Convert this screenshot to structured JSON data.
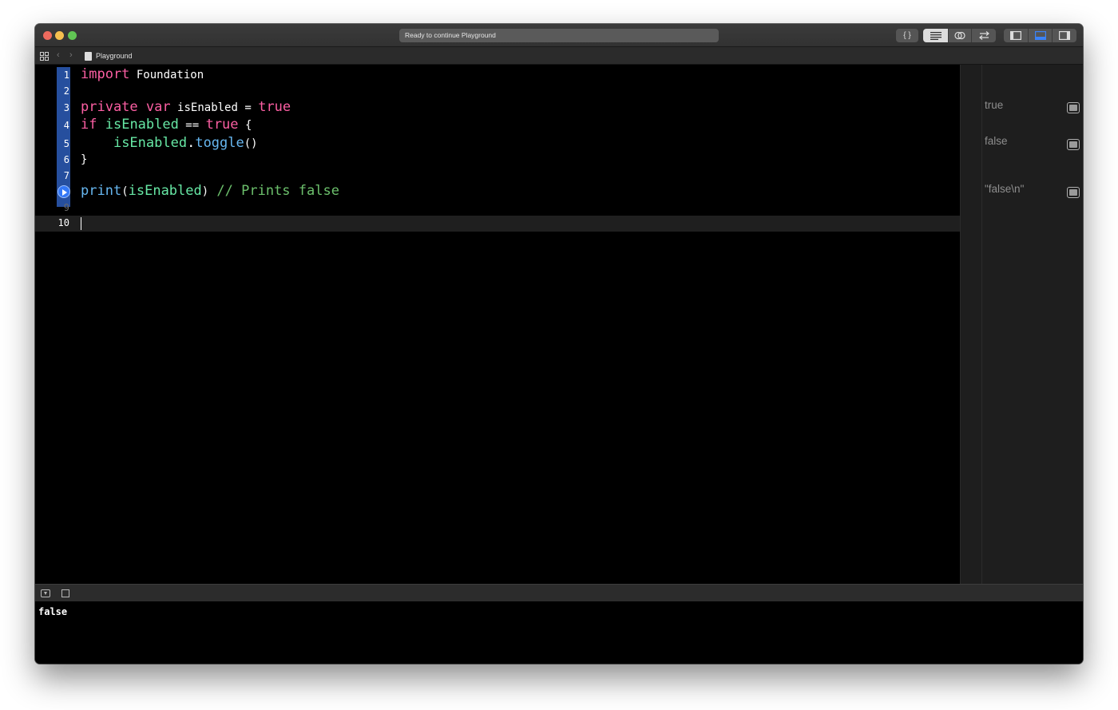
{
  "window": {
    "status": "Ready to continue Playground"
  },
  "toolbar": {
    "code_review_label": "{ }",
    "standard_editor_icon": "lines-icon",
    "assistant_editor_icon": "overlap-circles-icon",
    "version_editor_icon": "swap-arrows-icon",
    "navigator_icon": "left-panel-icon",
    "debug_area_icon": "bottom-panel-icon",
    "inspector_icon": "right-panel-icon"
  },
  "jumpbar": {
    "back": "‹",
    "forward": "›",
    "file_name": "Playground"
  },
  "editor": {
    "line_numbers": [
      "1",
      "2",
      "3",
      "4",
      "5",
      "6",
      "7",
      "",
      "9",
      "10"
    ],
    "lines": [
      {
        "t1": "import",
        "t2": " Foundation"
      },
      {
        "t1": "private",
        "t2": " ",
        "t3": "var",
        "t4": " isEnabled = ",
        "t5": "true"
      },
      {
        "t1": "if",
        "t2": " ",
        "t3": "isEnabled",
        "t4": " == ",
        "t5": "true",
        "t6": " {"
      },
      {
        "t1": "    ",
        "t2": "isEnabled",
        "t3": ".",
        "t4": "toggle",
        "t5": "()"
      },
      {
        "t1": "}"
      },
      {
        "t1": "print",
        "t2": "(",
        "t3": "isEnabled",
        "t4": ")",
        "t5": " // Prints false"
      }
    ]
  },
  "results": {
    "items": [
      "true",
      "false",
      "\"false\\n\""
    ]
  },
  "console": {
    "output": "false"
  },
  "colors": {
    "keyword": "#fc5fa3",
    "function": "#67b7f0",
    "variable": "#67e8a5",
    "comment": "#6cc06c",
    "selection": "#264f9e"
  }
}
